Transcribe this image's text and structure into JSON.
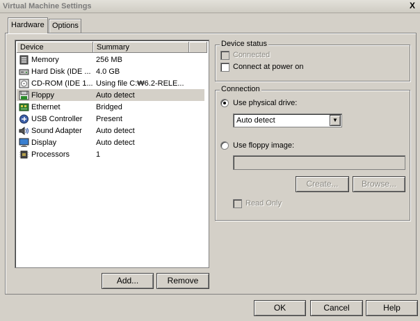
{
  "window": {
    "title": "Virtual Machine Settings",
    "close_label": "X"
  },
  "tabs": [
    {
      "label": "Hardware",
      "active": true
    },
    {
      "label": "Options",
      "active": false
    }
  ],
  "device_list": {
    "columns": [
      "Device",
      "Summary"
    ],
    "rows": [
      {
        "device": "Memory",
        "summary": "256 MB",
        "icon": "memory-icon"
      },
      {
        "device": "Hard Disk (IDE ...",
        "summary": "4.0 GB",
        "icon": "hard-disk-icon"
      },
      {
        "device": "CD-ROM (IDE 1...",
        "summary": "Using file C:₩6.2-RELE...",
        "icon": "cdrom-icon"
      },
      {
        "device": "Floppy",
        "summary": "Auto detect",
        "icon": "floppy-icon",
        "selected": true
      },
      {
        "device": "Ethernet",
        "summary": "Bridged",
        "icon": "ethernet-icon"
      },
      {
        "device": "USB Controller",
        "summary": "Present",
        "icon": "usb-icon"
      },
      {
        "device": "Sound Adapter",
        "summary": "Auto detect",
        "icon": "sound-icon"
      },
      {
        "device": "Display",
        "summary": "Auto detect",
        "icon": "display-icon"
      },
      {
        "device": "Processors",
        "summary": "1",
        "icon": "processor-icon"
      }
    ]
  },
  "list_buttons": {
    "add": "Add...",
    "remove": "Remove"
  },
  "device_status": {
    "title": "Device status",
    "connected": {
      "label": "Connected",
      "checked": false,
      "disabled": true
    },
    "connect_at_power_on": {
      "label": "Connect at power on",
      "checked": false
    }
  },
  "connection": {
    "title": "Connection",
    "use_physical_drive": {
      "label": "Use physical drive:",
      "selected": true
    },
    "drive_select": {
      "value": "Auto detect"
    },
    "use_floppy_image": {
      "label": "Use floppy image:",
      "selected": false
    },
    "image_path": "",
    "create_button": "Create...",
    "browse_button": "Browse...",
    "read_only": {
      "label": "Read Only",
      "checked": false,
      "disabled": true
    }
  },
  "footer": {
    "ok": "OK",
    "cancel": "Cancel",
    "help": "Help"
  }
}
